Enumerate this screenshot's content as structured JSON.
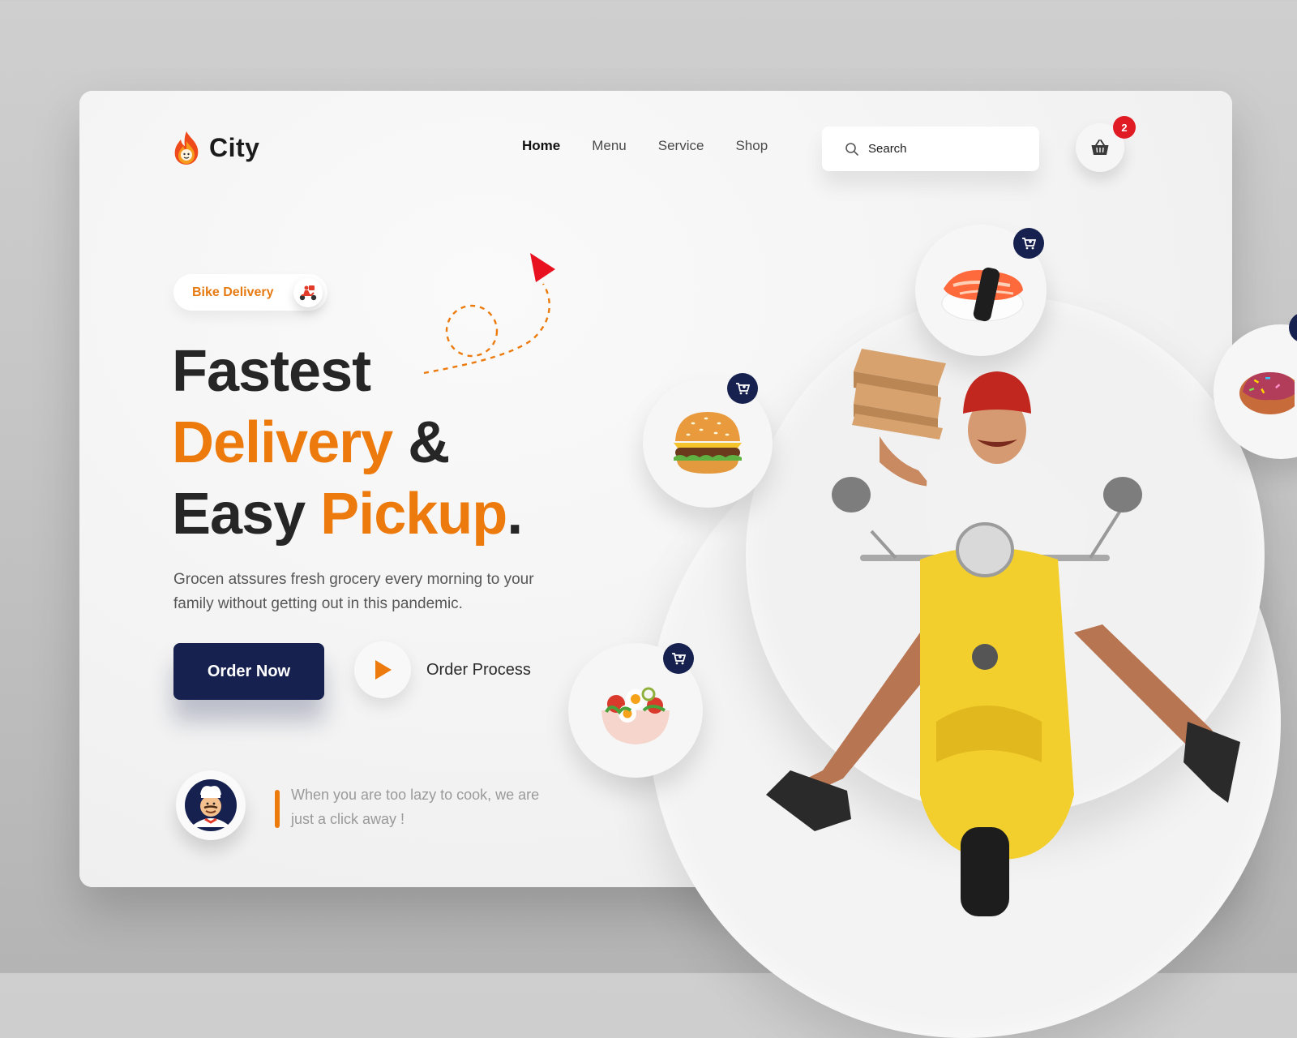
{
  "brand": {
    "name": "City"
  },
  "nav": {
    "items": [
      "Home",
      "Menu",
      "Service",
      "Shop"
    ],
    "active": "Home"
  },
  "search": {
    "placeholder": "Search"
  },
  "cart": {
    "count": "2"
  },
  "hero": {
    "tag": "Bike Delivery",
    "headline": {
      "w1": "Fastest",
      "w2": "Delivery",
      "w3": "&",
      "w4": "Easy",
      "w5": "Pickup",
      "w6": "."
    },
    "subtitle": "Grocen atssures fresh grocery every morning to your family without getting out in this pandemic.",
    "cta_primary": "Order Now",
    "cta_secondary": "Order Process"
  },
  "quote": {
    "text": "When you are too lazy to cook, we are just a click away !"
  },
  "food_items": [
    {
      "name": "sushi",
      "icon": "add-to-cart-icon"
    },
    {
      "name": "burger",
      "icon": "add-to-cart-icon"
    },
    {
      "name": "salad",
      "icon": "add-to-cart-icon"
    },
    {
      "name": "donut",
      "icon": "add-to-cart-icon"
    }
  ],
  "colors": {
    "accent": "#ec7a0c",
    "navy": "#16214f",
    "badge": "#e01b24",
    "scooter": "#f2cf2c"
  }
}
